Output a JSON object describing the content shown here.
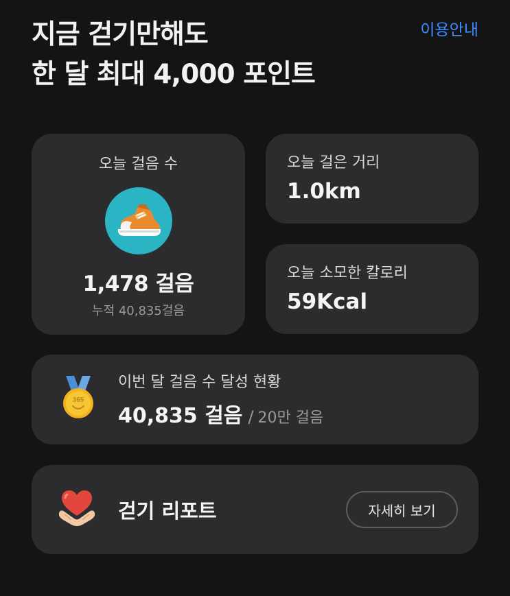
{
  "header": {
    "title_line1": "지금 걷기만해도",
    "title_line2": "한 달 최대 4,000 포인트",
    "guide_link": "이용안내"
  },
  "today_steps": {
    "label": "오늘 걸음 수",
    "value": "1,478 걸음",
    "cumulative": "누적 40,835걸음",
    "icon": "sneaker-icon"
  },
  "distance": {
    "label": "오늘 걸은 거리",
    "value": "1.0km"
  },
  "calories": {
    "label": "오늘 소모한 칼로리",
    "value": "59Kcal"
  },
  "monthly": {
    "label": "이번 달 걸음 수 달성 현황",
    "value": "40,835 걸음",
    "separator": "/",
    "goal": "20만 걸음",
    "icon": "medal-icon",
    "medal_text": "365"
  },
  "report": {
    "title": "걷기 리포트",
    "button_label": "자세히 보기",
    "icon": "heart-hands-icon"
  },
  "colors": {
    "background": "#141414",
    "card": "#2c2c2e",
    "link": "#3d8bff",
    "shoe_circle": "#2bb5c4"
  }
}
